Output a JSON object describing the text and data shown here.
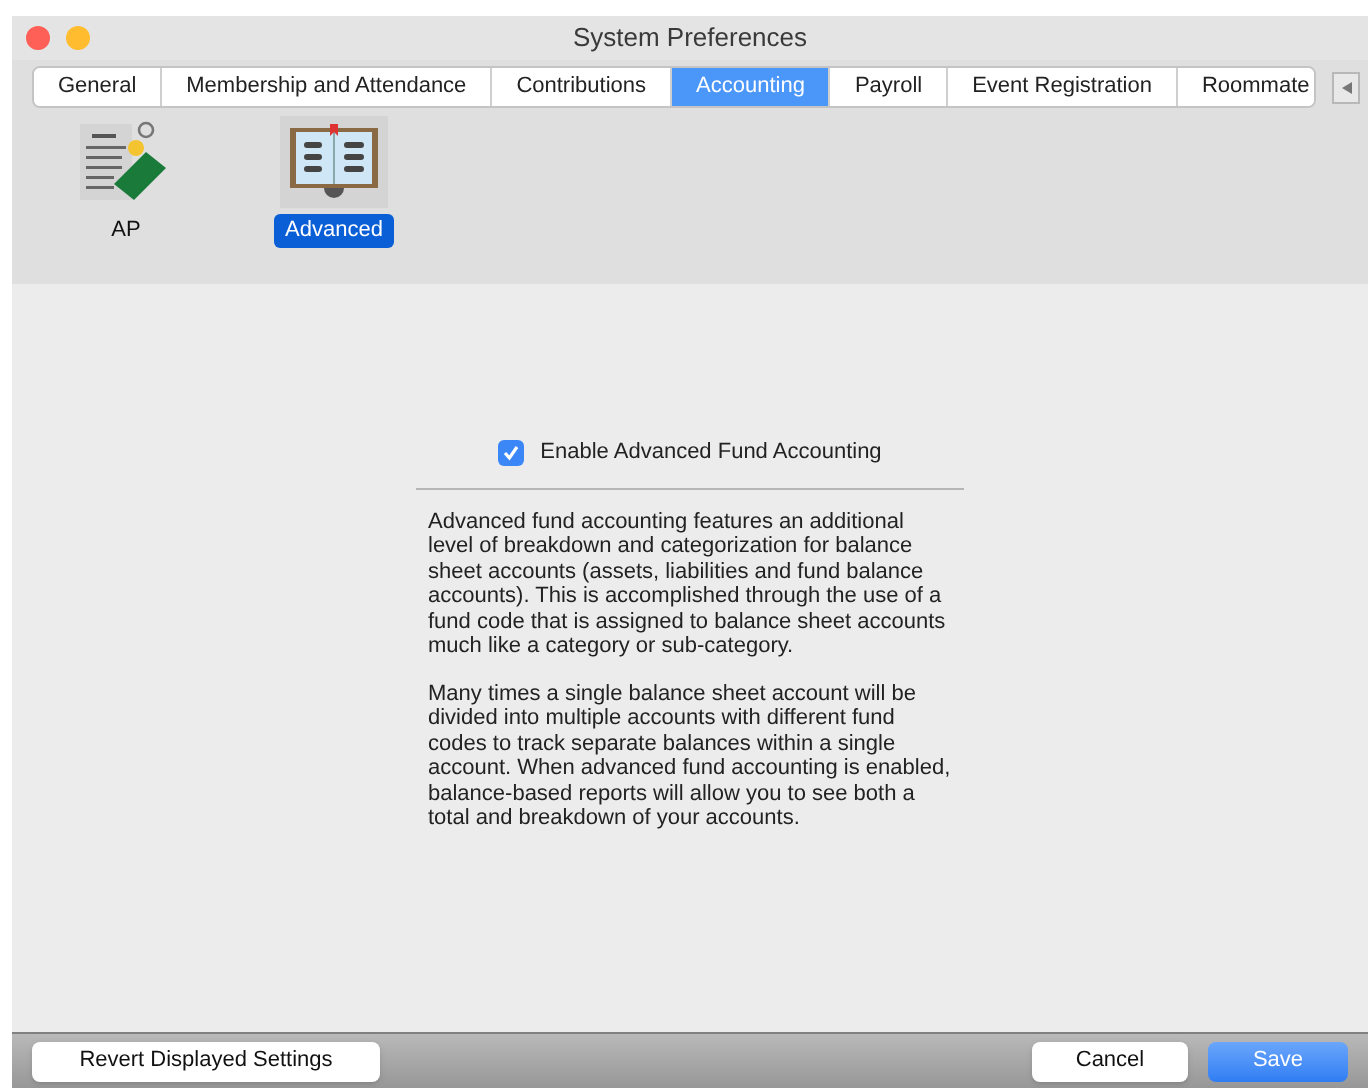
{
  "window": {
    "title": "System Preferences"
  },
  "tabs": [
    {
      "label": "General",
      "selected": false
    },
    {
      "label": "Membership and Attendance",
      "selected": false
    },
    {
      "label": "Contributions",
      "selected": false
    },
    {
      "label": "Accounting",
      "selected": true
    },
    {
      "label": "Payroll",
      "selected": false
    },
    {
      "label": "Event Registration",
      "selected": false
    },
    {
      "label": "Roommate",
      "selected": false
    }
  ],
  "sections": [
    {
      "kind": "ap",
      "label": "AP",
      "selected": false
    },
    {
      "kind": "advanced",
      "label": "Advanced",
      "selected": true
    }
  ],
  "option": {
    "label": "Enable Advanced Fund Accounting",
    "checked": true
  },
  "paragraphs": [
    "Advanced fund accounting features an additional level of breakdown and categorization for balance sheet accounts (assets, liabilities and fund balance accounts). This is accomplished through the use of a fund code that is assigned to balance sheet accounts much like a category or sub-category.",
    "Many times a single balance sheet account will be divided into multiple accounts with different fund codes to track separate balances within a single account. When advanced fund accounting is enabled, balance-based reports will allow you to see both a total and breakdown of your accounts."
  ],
  "buttons": {
    "revert": "Revert Displayed Settings",
    "cancel": "Cancel",
    "save": "Save"
  }
}
